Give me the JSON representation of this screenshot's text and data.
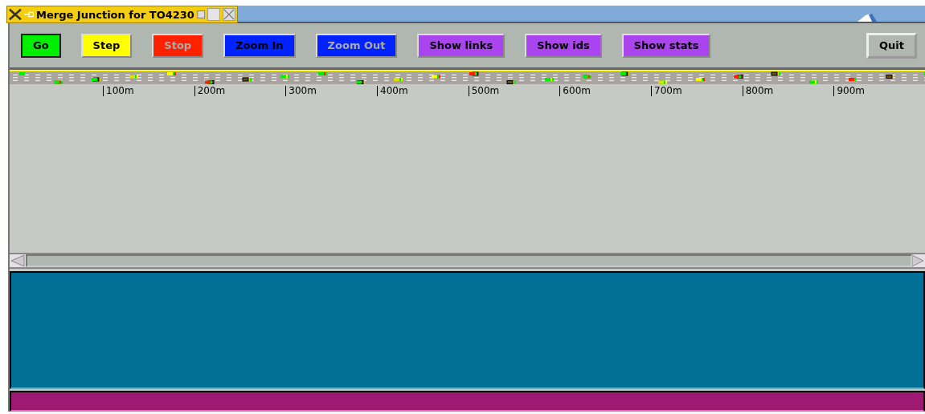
{
  "window": {
    "title": "Merge Junction for TO4230"
  },
  "toolbar": {
    "buttons": [
      {
        "label": "Go",
        "color": "#00ee00",
        "pressed": true,
        "disabled": false
      },
      {
        "label": "Step",
        "color": "#ffff00",
        "pressed": false,
        "disabled": false
      },
      {
        "label": "Stop",
        "color": "#ff2200",
        "pressed": false,
        "disabled": true
      },
      {
        "label": "Zoom In",
        "color": "#0022ff",
        "pressed": false,
        "disabled": false
      },
      {
        "label": "Zoom Out",
        "color": "#0022ff",
        "pressed": false,
        "disabled": true
      },
      {
        "label": "Show links",
        "color": "#aa44ee",
        "pressed": false,
        "disabled": false
      },
      {
        "label": "Show ids",
        "color": "#aa44ee",
        "pressed": false,
        "disabled": false
      },
      {
        "label": "Show stats",
        "color": "#aa44ee",
        "pressed": false,
        "disabled": false
      }
    ],
    "quit": {
      "label": "Quit"
    }
  },
  "scale": {
    "ticks": [
      "100m",
      "200m",
      "300m",
      "400m",
      "500m",
      "600m",
      "700m",
      "800m",
      "900m"
    ]
  }
}
